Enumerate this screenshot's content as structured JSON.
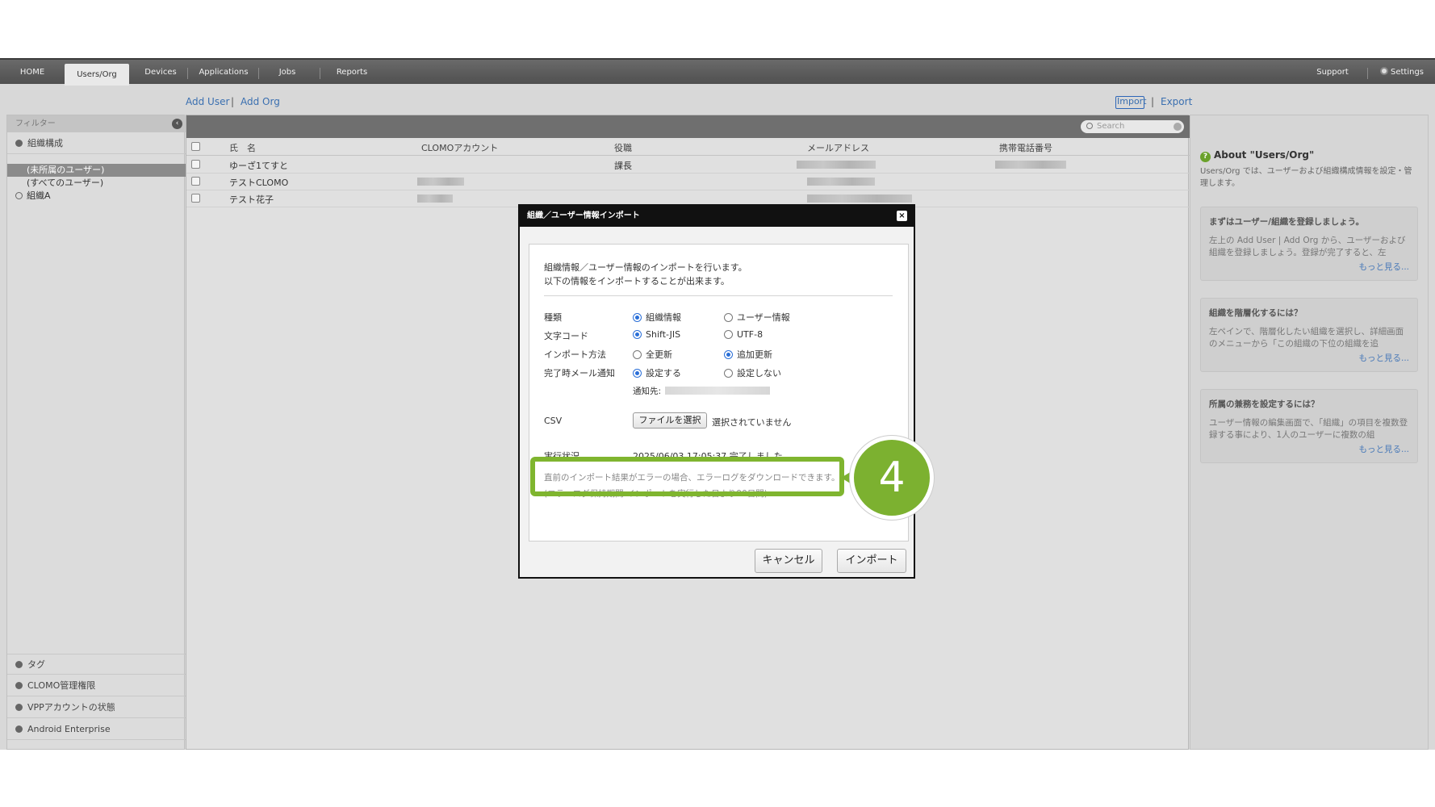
{
  "nav": {
    "tabs": [
      "HOME",
      "Users/Org",
      "Devices",
      "Applications",
      "Jobs",
      "Reports"
    ],
    "active_tab": "Users/Org",
    "support": "Support",
    "settings": "Settings"
  },
  "actions": {
    "add_user": "Add User",
    "sep": "|",
    "add_org": "Add Org",
    "import": "Import",
    "export": "Export"
  },
  "sidebar": {
    "filter_label": "フィルター",
    "org_section": "組織構成",
    "items": [
      "(未所属のユーザー)",
      "(すべてのユーザー)",
      "組織A"
    ],
    "selected_item": "(未所属のユーザー)",
    "bottom_sections": [
      "タグ",
      "CLOMO管理権限",
      "VPPアカウントの状態",
      "Android Enterprise"
    ]
  },
  "table": {
    "search_placeholder": "Search",
    "columns": [
      "氏　名",
      "CLOMOアカウント",
      "役職",
      "メールアドレス",
      "携帯電話番号"
    ],
    "rows": [
      {
        "name": "ゆーざ1てすと",
        "title": "課長"
      },
      {
        "name": "テストCLOMO",
        "title": ""
      },
      {
        "name": "テスト花子",
        "title": ""
      }
    ]
  },
  "right_panel": {
    "title": "About \"Users/Org\"",
    "desc": "Users/Org では、ユーザーおよび組織構成情報を設定・管理します。",
    "cards": [
      {
        "title": "まずはユーザー/組織を登録しましょう。",
        "body": "左上の Add User | Add Org から、ユーザーおよび組織を登録しましょう。登録が完了すると、左",
        "more": "もっと見る..."
      },
      {
        "title": "組織を階層化するには？",
        "body": "左ペインで、階層化したい組織を選択し、詳細画面のメニューから「この組織の下位の組織を追",
        "more": "もっと見る..."
      },
      {
        "title": "所属の兼務を設定するには？",
        "body": "ユーザー情報の編集画面で、「組織」の項目を複数登録する事により、1人のユーザーに複数の組",
        "more": "もっと見る..."
      }
    ]
  },
  "dialog": {
    "title": "組織／ユーザー情報インポート",
    "close_icon": "×",
    "intro_line1": "組織情報／ユーザー情報のインポートを行います。",
    "intro_line2": "以下の情報をインポートすることが出来ます。",
    "fields": {
      "kind": {
        "label": "種類",
        "opt1": "組織情報",
        "opt2": "ユーザー情報",
        "selected": 1
      },
      "encoding": {
        "label": "文字コード",
        "opt1": "Shift-JIS",
        "opt2": "UTF-8",
        "selected": 1
      },
      "method": {
        "label": "インポート方法",
        "opt1": "全更新",
        "opt2": "追加更新",
        "selected": 2
      },
      "notify": {
        "label": "完了時メール通知",
        "opt1": "設定する",
        "opt2": "設定しない",
        "selected": 1
      },
      "notify_to": "通知先:"
    },
    "csv_label": "CSV",
    "file_button": "ファイルを選択",
    "file_status": "選択されていません",
    "status_label": "実行状況",
    "status_value": "2025/06/03 17:05:37 完了しました。",
    "note1": "直前のインポート結果がエラーの場合、エラーログをダウンロードできます。",
    "note2": "(エラーログ保持期間:インポートを実行した日より90日間)",
    "cancel": "キャンセル",
    "import": "インポート"
  },
  "annotation": {
    "step": "4",
    "color": "#7cb130"
  }
}
